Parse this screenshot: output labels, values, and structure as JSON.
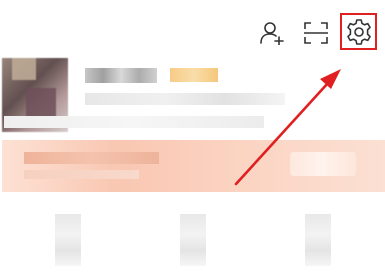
{
  "header": {
    "icons": [
      "add-friend-icon",
      "scan-icon",
      "settings-icon"
    ]
  },
  "annotation": {
    "highlight_color": "#e02020",
    "target": "settings-icon"
  },
  "banner": {
    "color": "#f9c7b2"
  }
}
